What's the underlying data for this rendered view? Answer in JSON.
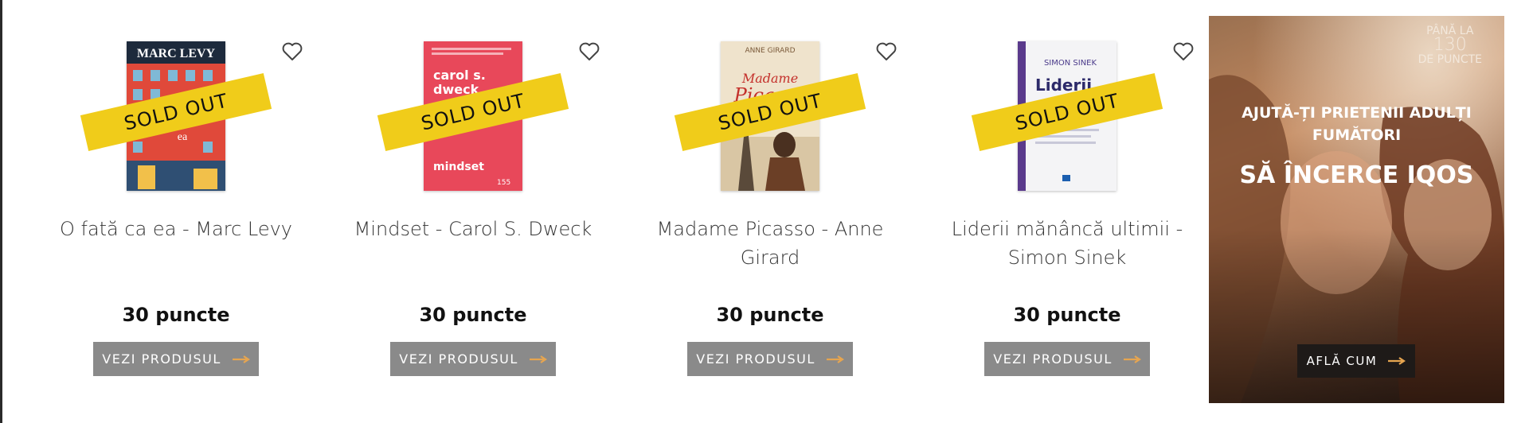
{
  "products": [
    {
      "title": "O fată ca ea - Marc Levy",
      "price": "30 puncte",
      "button_label": "VEZI PRODUSUL",
      "sold_out_label": "SOLD OUT",
      "cover": {
        "author": "MARC LEVY",
        "title_fragment": "ea"
      }
    },
    {
      "title": "Mindset - Carol S. Dweck",
      "price": "30 puncte",
      "button_label": "VEZI PRODUSUL",
      "sold_out_label": "SOLD OUT",
      "cover": {
        "author_line1": "carol s.",
        "author_line2": "dweck",
        "book_title": "mindset",
        "number": "155"
      }
    },
    {
      "title": "Madame Picasso - Anne Girard",
      "price": "30 puncte",
      "button_label": "VEZI PRODUSUL",
      "sold_out_label": "SOLD OUT",
      "cover": {
        "author": "ANNE GIRARD",
        "title_line1": "Madame",
        "title_line2": "Picasso"
      }
    },
    {
      "title": "Liderii mănâncă ultimii - Simon Sinek",
      "price": "30 puncte",
      "button_label": "VEZI PRODUSUL",
      "sold_out_label": "SOLD OUT",
      "cover": {
        "author": "SIMON SINEK",
        "book_title": "Liderii"
      }
    }
  ],
  "promo": {
    "badge_line1": "PÂNĂ LA",
    "badge_line2": "130",
    "badge_line3": "DE PUNCTE",
    "subtitle": "AJUTĂ-ȚI PRIETENII ADULȚI FUMĂTORI",
    "headline": "SĂ ÎNCERCE IQOS",
    "button_label": "AFLĂ CUM"
  },
  "colors": {
    "sold_out_band": "#f0cc1a",
    "button_bg": "#8a8a8a",
    "arrow": "#e6a550",
    "promo_button_bg": "#1e1a18"
  },
  "icons": {
    "wishlist": "heart-outline-icon",
    "arrow": "arrow-right-icon"
  }
}
